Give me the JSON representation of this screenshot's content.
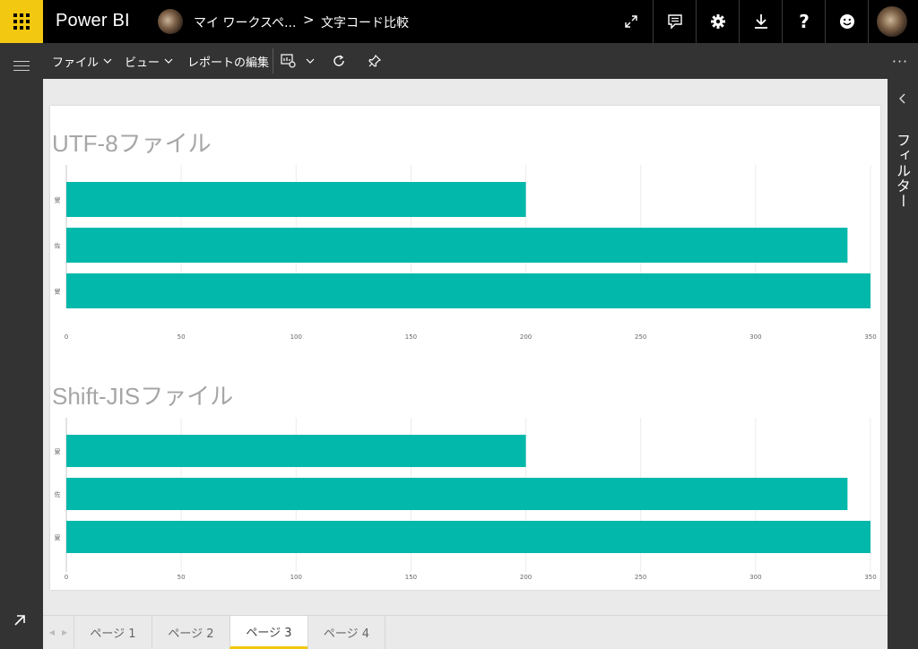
{
  "app": {
    "brand": "Power BI",
    "workspace": "マイ ワークスペ...",
    "breadcrumb_sep": ">",
    "report": "文字コード比較"
  },
  "topbar_icons": [
    "expand-icon",
    "comment-icon",
    "gear-icon",
    "download-icon",
    "help-icon",
    "smiley-icon"
  ],
  "toolbar": {
    "file_label": "ファイル",
    "view_label": "ビュー",
    "edit_label": "レポートの編集",
    "more_label": "···"
  },
  "filter_pane": {
    "label": "フィルター"
  },
  "charts": [
    {
      "title": "UTF-8ファイル"
    },
    {
      "title": "Shift-JISファイル"
    }
  ],
  "chart_data": [
    {
      "type": "bar",
      "orientation": "horizontal",
      "title": "UTF-8ファイル",
      "categories": [
        "叟",
        "佐",
        "叟"
      ],
      "values": [
        200,
        340,
        350
      ],
      "xlim": [
        0,
        350
      ],
      "xticks": [
        0,
        50,
        100,
        150,
        200,
        250,
        300,
        350
      ],
      "color": "#01b8aa",
      "grid": "vertical"
    },
    {
      "type": "bar",
      "orientation": "horizontal",
      "title": "Shift-JISファイル",
      "categories": [
        "叟",
        "佐",
        "叟"
      ],
      "values": [
        200,
        340,
        350
      ],
      "xlim": [
        0,
        350
      ],
      "xticks": [
        0,
        50,
        100,
        150,
        200,
        250,
        300,
        350
      ],
      "color": "#01b8aa",
      "grid": "vertical"
    }
  ],
  "page_tabs": [
    {
      "label": "ページ 1",
      "active": false
    },
    {
      "label": "ページ 2",
      "active": false
    },
    {
      "label": "ページ 3",
      "active": true
    },
    {
      "label": "ページ 4",
      "active": false
    }
  ]
}
